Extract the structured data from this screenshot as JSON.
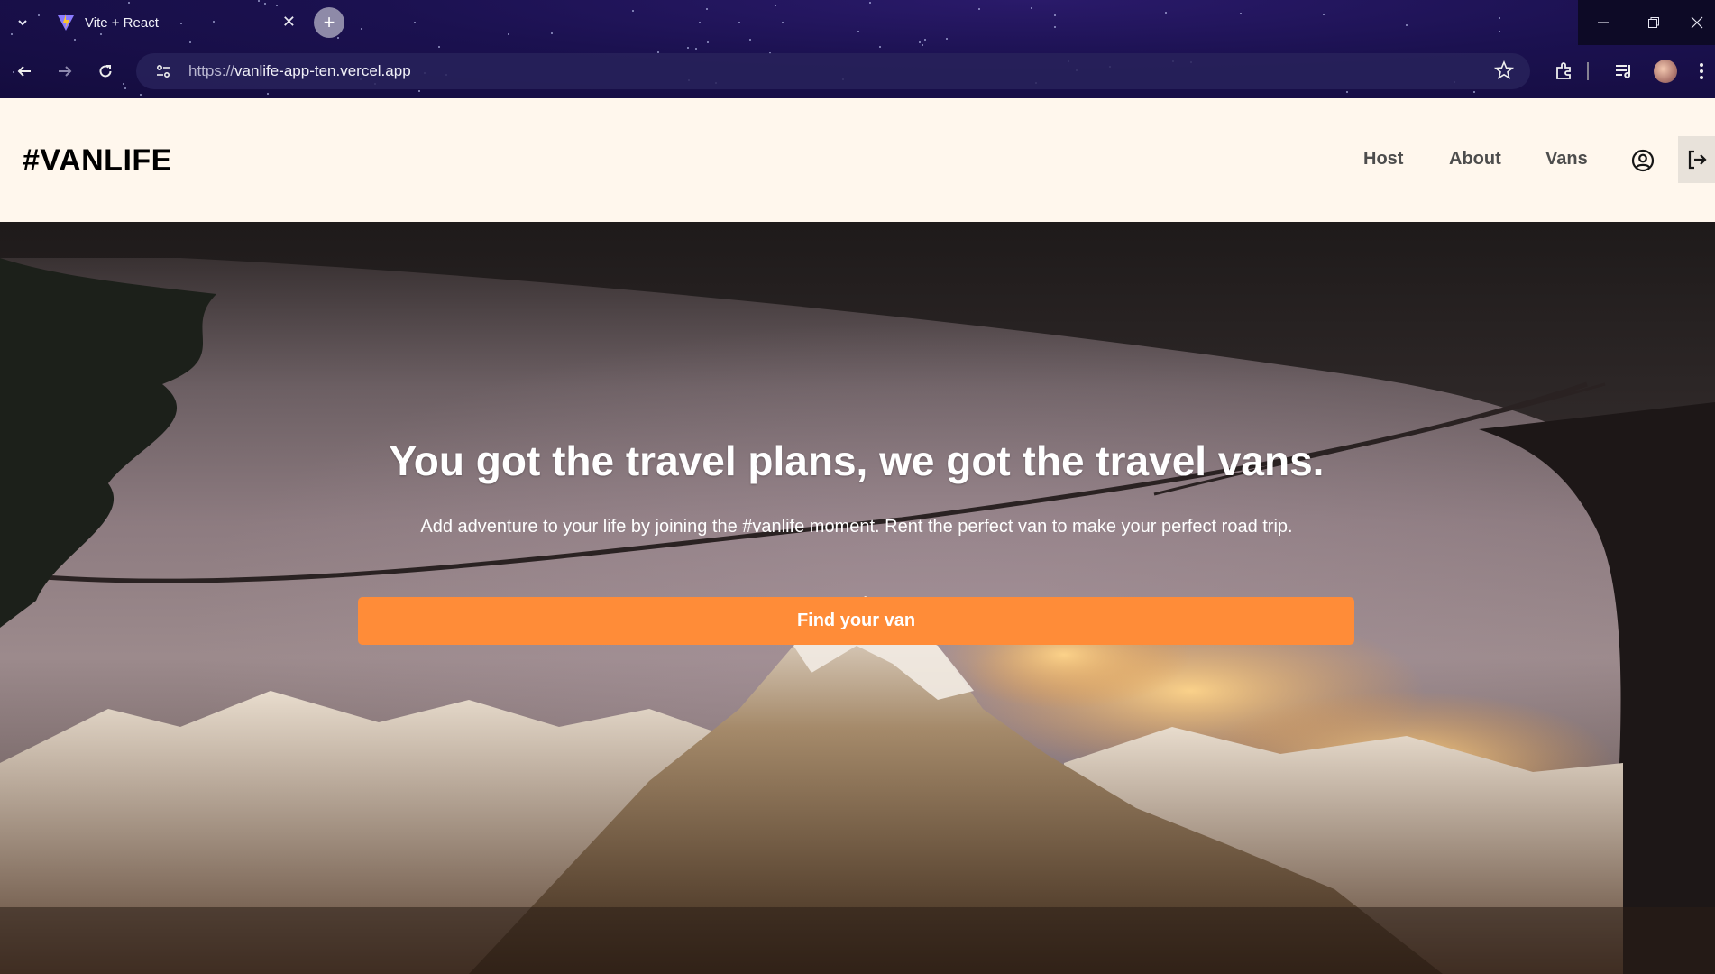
{
  "browser": {
    "tab": {
      "title": "Vite + React",
      "favicon": "vite-icon"
    },
    "address": {
      "scheme": "https://",
      "host": "vanlife-app-ten.vercel.app"
    },
    "icons": [
      "tab-dropdown-icon",
      "close-icon",
      "new-tab-icon",
      "back-icon",
      "forward-icon",
      "reload-icon",
      "site-info-icon",
      "bookmark-star-icon",
      "extensions-icon",
      "media-control-icon",
      "profile-avatar",
      "more-menu-icon",
      "minimize-icon",
      "restore-icon",
      "window-close-icon"
    ]
  },
  "header": {
    "logo": "#VANLIFE",
    "nav": {
      "host": "Host",
      "about": "About",
      "vans": "Vans"
    },
    "icons": [
      "account-icon",
      "logout-icon"
    ]
  },
  "hero": {
    "title": "You got the travel plans, we got the travel vans.",
    "subtitle": "Add adventure to your life by joining the #vanlife moment. Rent the perfect van to make your perfect road trip.",
    "cta": "Find your van",
    "background": "mountain view through van window"
  },
  "colors": {
    "header_bg": "#fff7ed",
    "accent": "#ff8c38",
    "nav_text": "#4d4d4d",
    "chrome_bg": "#1b1150"
  }
}
